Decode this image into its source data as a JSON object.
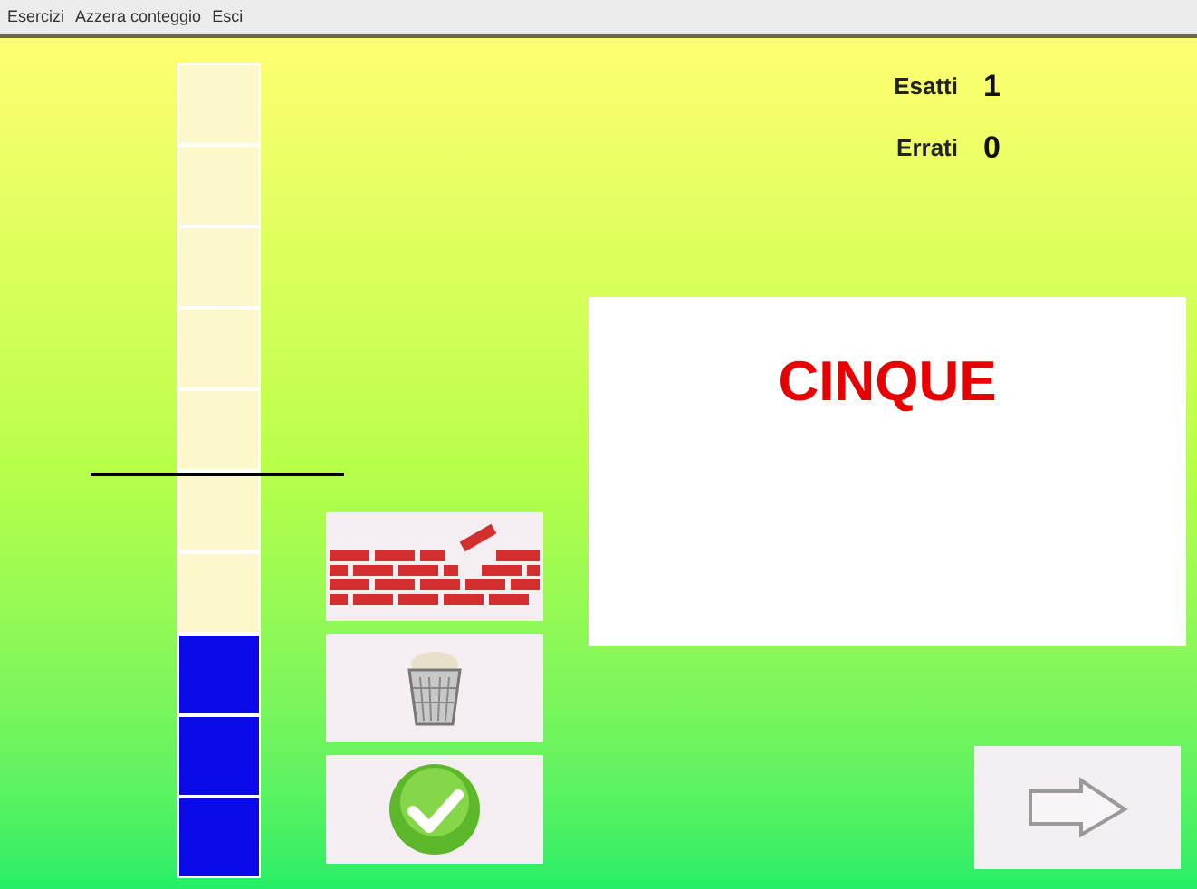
{
  "menu": [
    {
      "label": "Esercizi"
    },
    {
      "label": "Azzera conteggio"
    },
    {
      "label": "Esci"
    }
  ],
  "tower": {
    "cells": [
      {
        "filled": false
      },
      {
        "filled": false
      },
      {
        "filled": false
      },
      {
        "filled": false
      },
      {
        "filled": false
      },
      {
        "filled": false
      },
      {
        "filled": false
      },
      {
        "filled": true
      },
      {
        "filled": true
      },
      {
        "filled": true
      }
    ]
  },
  "score": [
    {
      "label": "Esatti",
      "value": "1"
    },
    {
      "label": "Errati",
      "value": "0"
    }
  ],
  "word": "CINQUE",
  "next_button": {
    "disabled": true
  }
}
